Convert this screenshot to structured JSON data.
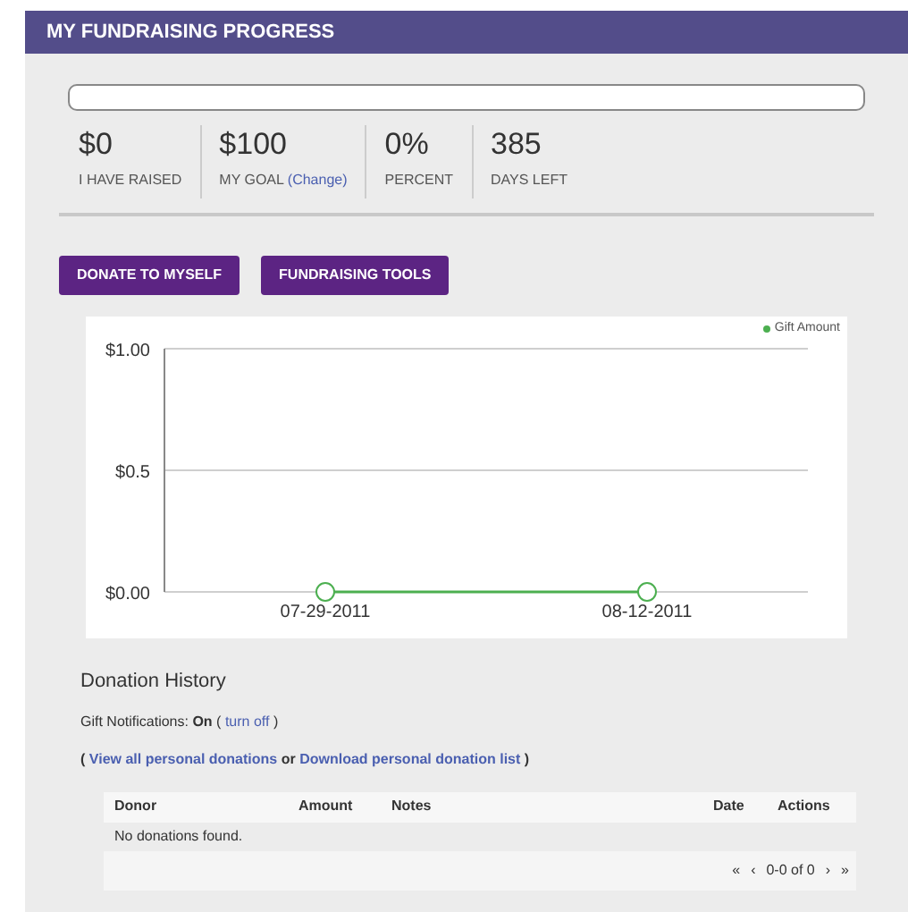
{
  "header": {
    "title": "MY FUNDRAISING PROGRESS"
  },
  "progress": {
    "level": 0
  },
  "stats": [
    {
      "value": "$0",
      "label": "I HAVE RAISED"
    },
    {
      "value": "$100",
      "label": "MY GOAL",
      "link": "(Change)"
    },
    {
      "value": "0%",
      "label": "PERCENT"
    },
    {
      "value": "385",
      "label": "DAYS LEFT"
    }
  ],
  "buttons": [
    "DONATE TO MYSELF",
    "FUNDRAISING TOOLS"
  ],
  "chart": {
    "chart_data": {
      "type": "line",
      "categories": [
        "07-29-2011",
        "08-12-2011"
      ],
      "series": [
        {
          "name": "Gift Amount",
          "color": "#4caf50",
          "marker": "circle",
          "values": [
            0,
            0
          ]
        }
      ],
      "ylim": [
        0,
        1
      ],
      "yticks": [
        {
          "value": 0,
          "label": "$0.00"
        },
        {
          "value": 0.5,
          "label": "$0.5"
        },
        {
          "value": 1,
          "label": "$1.00"
        }
      ]
    }
  },
  "donation_history": {
    "title": "Donation History",
    "notifications": {
      "label": "Gift Notifications:",
      "status": "On",
      "open": "(",
      "link": "turn off",
      "close": ")"
    },
    "links": {
      "open": "(",
      "view_link": "View all personal donations",
      "or": "or",
      "download_link": "Download personal donation list",
      "close": ")"
    },
    "table": {
      "columns": [
        "Donor",
        "Amount",
        "Notes",
        "Date",
        "Actions"
      ],
      "empty_message": "No donations found."
    },
    "pagination": {
      "first": "«",
      "prev": "‹",
      "range": "0-0 of 0",
      "next": "›",
      "last": "»"
    }
  }
}
